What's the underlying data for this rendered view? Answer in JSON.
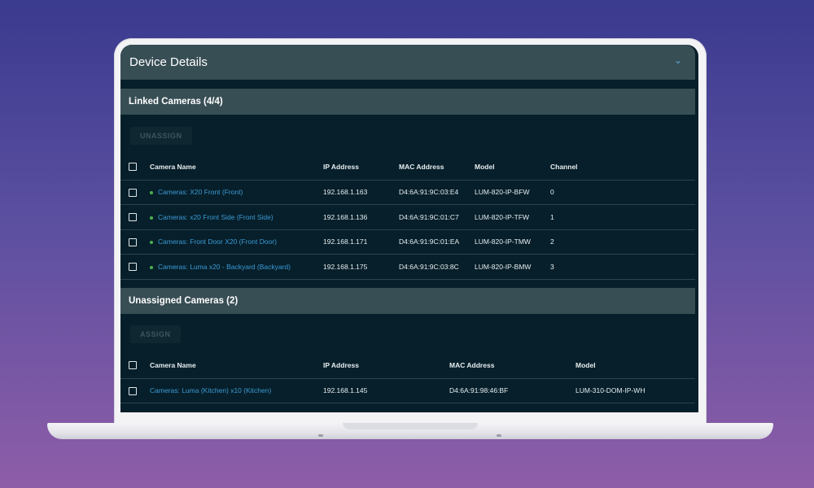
{
  "colors": {
    "screen_bg": "#061f2a",
    "bar_bg": "#384e55",
    "link": "#3d9ad6",
    "status_online": "#4caf50"
  },
  "panel": {
    "title": "Device Details",
    "chevron_icon": "chevron-down-icon"
  },
  "linked": {
    "title": "Linked Cameras (4/4)",
    "action_label": "UNASSIGN",
    "columns": [
      "Camera Name",
      "IP Address",
      "MAC Address",
      "Model",
      "Channel"
    ],
    "rows": [
      {
        "name": "Cameras: X20 Front (Front)",
        "ip": "192.168.1.163",
        "mac": "D4:6A:91:9C:03:E4",
        "model": "LUM-820-IP-BFW",
        "channel": "0"
      },
      {
        "name": "Cameras: x20 Front Side (Front Side)",
        "ip": "192.168.1.136",
        "mac": "D4:6A:91:9C:01:C7",
        "model": "LUM-820-IP-TFW",
        "channel": "1"
      },
      {
        "name": "Cameras: Front Door X20 (Front Door)",
        "ip": "192.168.1.171",
        "mac": "D4:6A:91:9C:01:EA",
        "model": "LUM-820-IP-TMW",
        "channel": "2"
      },
      {
        "name": "Cameras: Luma x20 - Backyard (Backyard)",
        "ip": "192.168.1.175",
        "mac": "D4:6A:91:9C:03:8C",
        "model": "LUM-820-IP-BMW",
        "channel": "3"
      }
    ]
  },
  "unassigned": {
    "title": "Unassigned Cameras (2)",
    "action_label": "ASSIGN",
    "columns": [
      "Camera Name",
      "IP Address",
      "MAC Address",
      "Model"
    ],
    "rows": [
      {
        "name": "Cameras: Luma (Kitchen) x10 (Kitchen)",
        "ip": "192.168.1.145",
        "mac": "D4:6A:91:98:46:BF",
        "model": "LUM-310-DOM-IP-WH"
      }
    ]
  }
}
